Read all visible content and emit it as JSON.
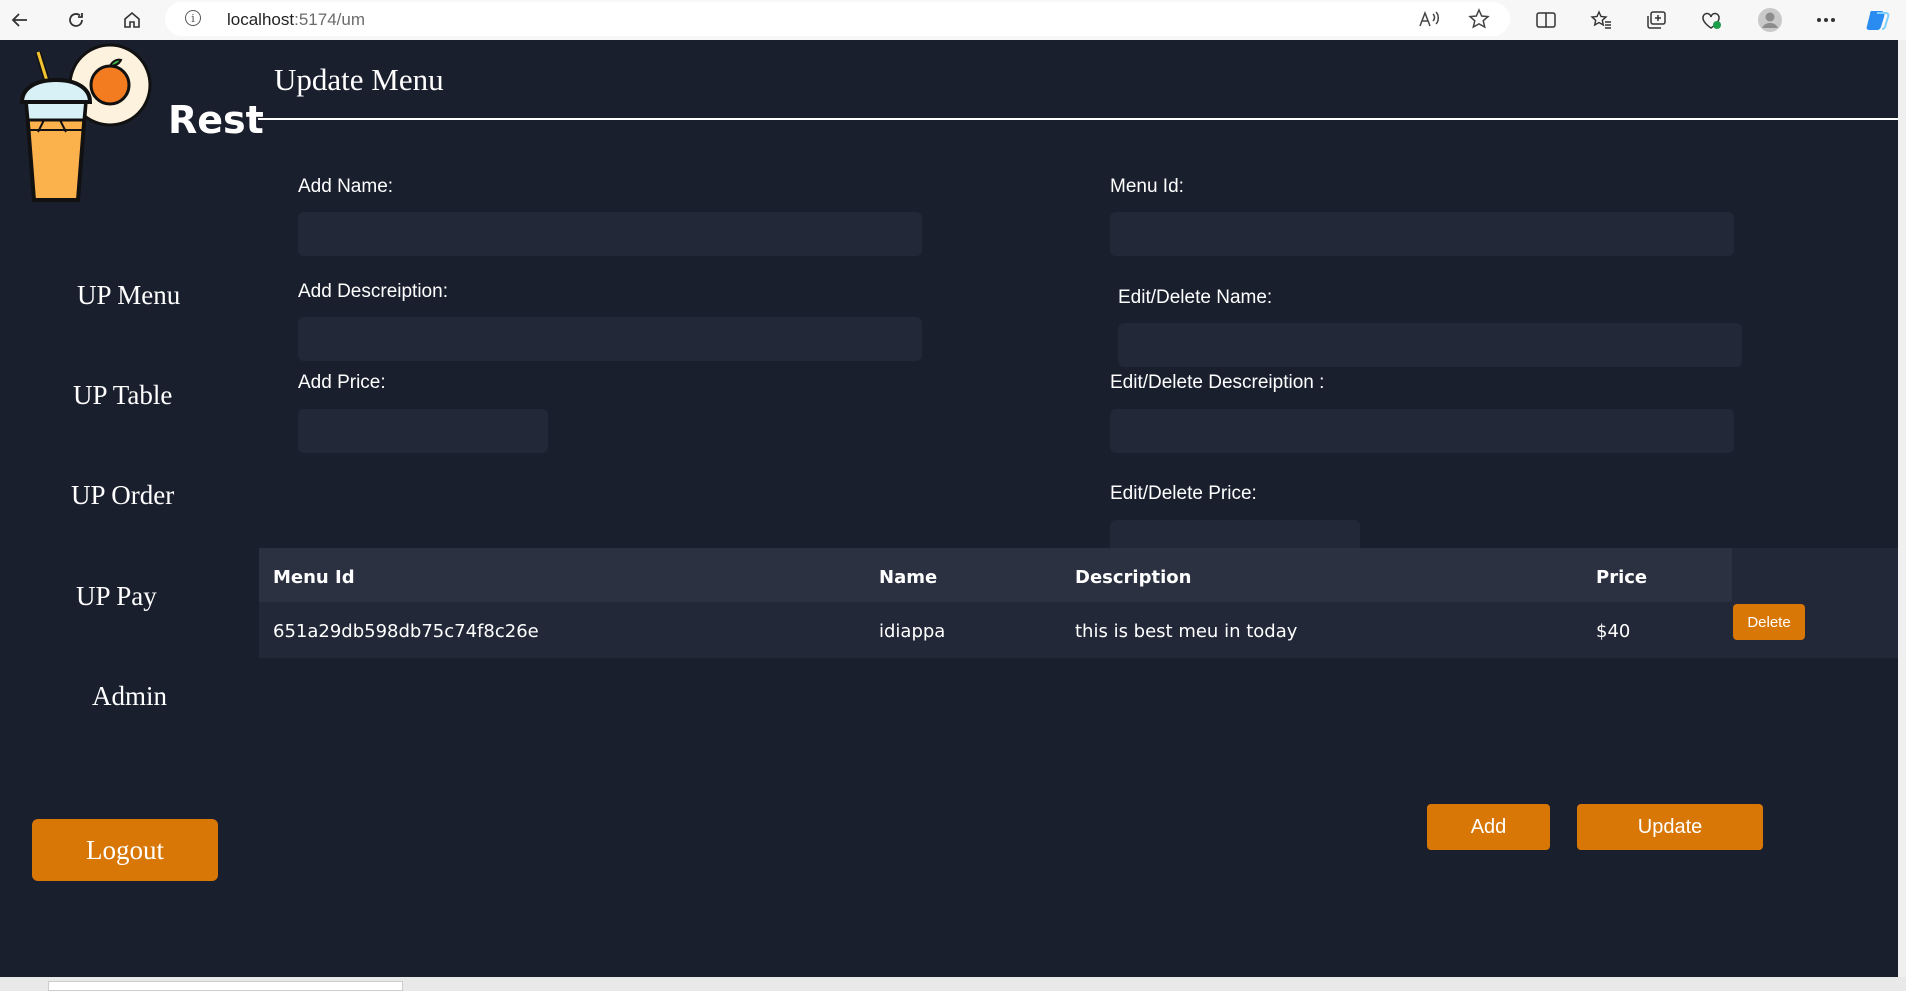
{
  "browser": {
    "url_host": "localhost",
    "url_path": ":5174/um"
  },
  "sidebar": {
    "brand": "Rest",
    "items": [
      {
        "label": "UP Menu"
      },
      {
        "label": "UP Table"
      },
      {
        "label": "UP Order"
      },
      {
        "label": "UP Pay"
      },
      {
        "label": "Admin"
      }
    ],
    "logout_label": "Logout"
  },
  "main": {
    "title": "Update Menu",
    "form": {
      "add_name_label": "Add Name:",
      "add_description_label": "Add Descreiption:",
      "add_price_label": "Add Price:",
      "menu_id_label": "Menu Id:",
      "edit_name_label": "Edit/Delete Name:",
      "edit_description_label": "Edit/Delete Descreiption :",
      "edit_price_label": "Edit/Delete Price:"
    },
    "table": {
      "headers": [
        "Menu Id",
        "Name",
        "Description",
        "Price"
      ],
      "rows": [
        {
          "menu_id": "651a29db598db75c74f8c26e",
          "name": "idiappa",
          "description": "this is best meu in today",
          "price": "$40",
          "delete_label": "Delete"
        }
      ]
    },
    "add_label": "Add",
    "update_label": "Update"
  },
  "colors": {
    "background": "#1a1f2e",
    "accent": "#d97706",
    "input_bg": "#222838"
  }
}
